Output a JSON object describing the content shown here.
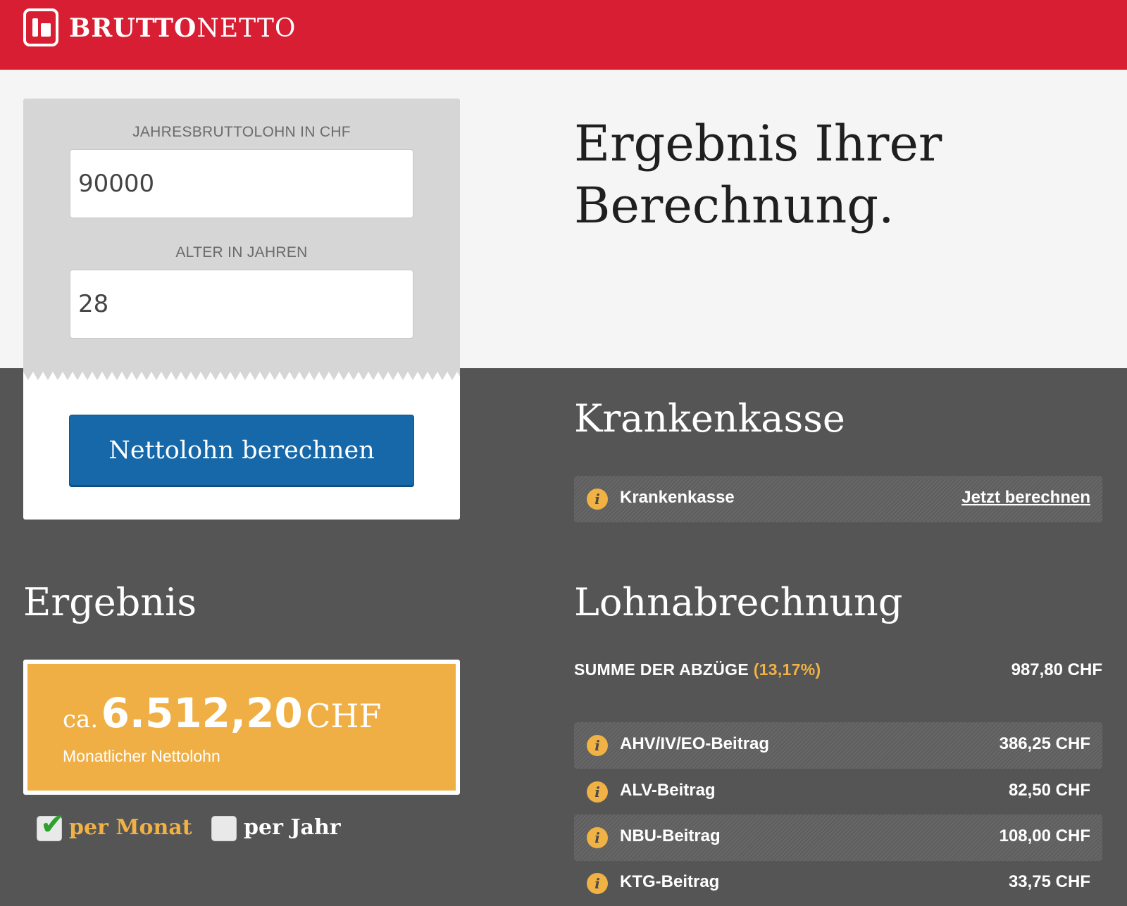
{
  "brand": {
    "bold": "BRUTTO",
    "light": "NETTO"
  },
  "form": {
    "salary_label": "JAHRESBRUTTOLOHN IN CHF",
    "salary_value": "90000",
    "age_label": "ALTER IN JAHREN",
    "age_value": "28",
    "submit_label": "Nettolohn berechnen"
  },
  "result_heading_line1": "Ergebnis Ihrer",
  "result_heading_line2": "Berechnung.",
  "krankenkasse": {
    "heading": "Krankenkasse",
    "info_glyph": "i",
    "row_label": "Krankenkasse",
    "link_label": "Jetzt berechnen"
  },
  "ergebnis": {
    "heading": "Ergebnis",
    "prefix": "ca.",
    "amount": "6.512,20",
    "currency": "CHF",
    "caption": "Monatlicher Nettolohn"
  },
  "period": {
    "monthly_label": "per Monat",
    "monthly_checked": true,
    "yearly_label": "per Jahr",
    "yearly_checked": false,
    "check_glyph": "✔"
  },
  "payslip": {
    "heading": "Lohnabrechnung",
    "sum_label": "SUMME DER ABZÜGE",
    "sum_percent": "(13,17%)",
    "sum_value": "987,80 CHF",
    "rows": [
      {
        "label": "AHV/IV/EO-Beitrag",
        "value": "386,25 CHF"
      },
      {
        "label": "ALV-Beitrag",
        "value": "82,50 CHF"
      },
      {
        "label": "NBU-Beitrag",
        "value": "108,00 CHF"
      },
      {
        "label": "KTG-Beitrag",
        "value": "33,75 CHF"
      }
    ]
  },
  "colors": {
    "brand_red": "#d71e32",
    "button_blue": "#1668a8",
    "accent_orange": "#efaf45",
    "dark_bg": "#555555"
  }
}
